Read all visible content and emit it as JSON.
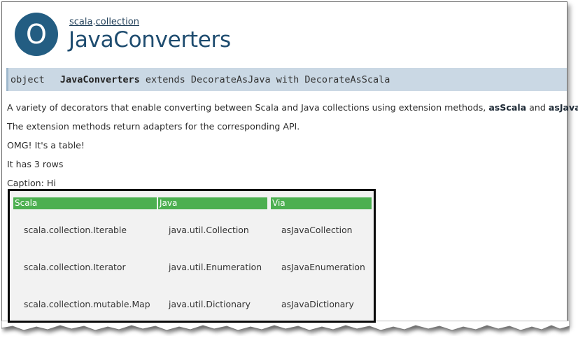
{
  "header": {
    "badge_letter": "O",
    "package_parent": "scala",
    "package_sep": ".",
    "package_child": "collection",
    "title": "JavaConverters"
  },
  "signature": {
    "keyword": "object",
    "name": "JavaConverters",
    "rest": "extends DecorateAsJava with DecorateAsScala"
  },
  "description": {
    "line1_prefix": "A variety of decorators that enable converting between Scala and Java collections using extension methods, ",
    "line1_bold1": "asScala",
    "line1_mid": " and ",
    "line1_bold2": "asJava",
    "line1_suffix": ".",
    "line2": "The extension methods return adapters for the corresponding API.",
    "line3": "OMG! It's a table!",
    "line4": "It has 3 rows",
    "caption": "Caption: Hi"
  },
  "table": {
    "headers": [
      "Scala",
      "Java",
      "Via"
    ],
    "rows": [
      [
        "scala.collection.Iterable",
        "java.util.Collection",
        "asJavaCollection"
      ],
      [
        "scala.collection.Iterator",
        "java.util.Enumeration",
        "asJavaEnumeration"
      ],
      [
        "scala.collection.mutable.Map",
        "java.util.Dictionary",
        "asJavaDictionary"
      ]
    ]
  },
  "colors": {
    "badge": "#235d82",
    "title": "#1e4c6f",
    "signature_bar": "#cad8e4",
    "table_header": "#4caf50"
  }
}
